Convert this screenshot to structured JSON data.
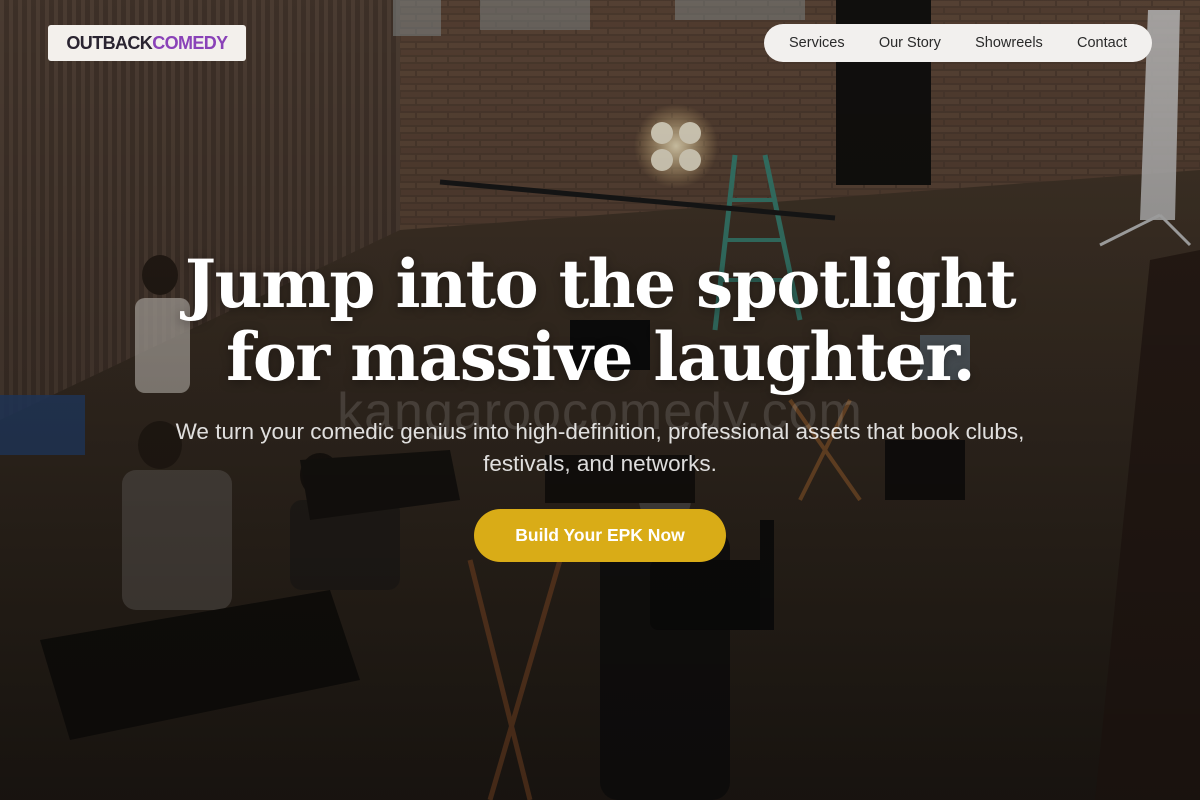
{
  "brand": {
    "logo_part_1": "OUTBACK",
    "logo_part_2": "COMEDY",
    "logo_colors": {
      "primary": "#2a2431",
      "accent": "#8a42b8"
    }
  },
  "nav": {
    "items": [
      "Services",
      "Our Story",
      "Showreels",
      "Contact"
    ]
  },
  "hero": {
    "headline_line_1": "Jump into the spotlight",
    "headline_line_2": "for massive laughter.",
    "watermark": "kangaroocomedy.com",
    "subheadline": "We turn your comedic genius into high-definition, professional assets that book clubs, festivals, and networks.",
    "cta_label": "Build Your EPK Now",
    "cta_color": "#d9ac17"
  }
}
